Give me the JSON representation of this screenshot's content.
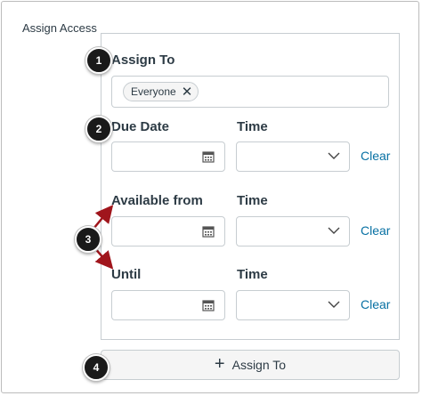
{
  "section_label": "Assign Access",
  "assign_to": {
    "label": "Assign To",
    "tags": [
      "Everyone"
    ]
  },
  "rows": [
    {
      "label": "Due Date",
      "time_label": "Time",
      "date_value": "",
      "time_value": "",
      "clear_label": "Clear"
    },
    {
      "label": "Available from",
      "time_label": "Time",
      "date_value": "",
      "time_value": "",
      "clear_label": "Clear"
    },
    {
      "label": "Until",
      "time_label": "Time",
      "date_value": "",
      "time_value": "",
      "clear_label": "Clear"
    }
  ],
  "add_button_label": "Assign To",
  "callouts": [
    "1",
    "2",
    "3",
    "4"
  ],
  "colors": {
    "link": "#0770a3",
    "callout": "#1a1a1a",
    "arrow": "#a0151c",
    "border": "#c7cdd1"
  },
  "icons": {
    "remove": "close-icon",
    "date": "calendar-icon",
    "time": "chevron-down-icon",
    "add": "plus-icon"
  }
}
